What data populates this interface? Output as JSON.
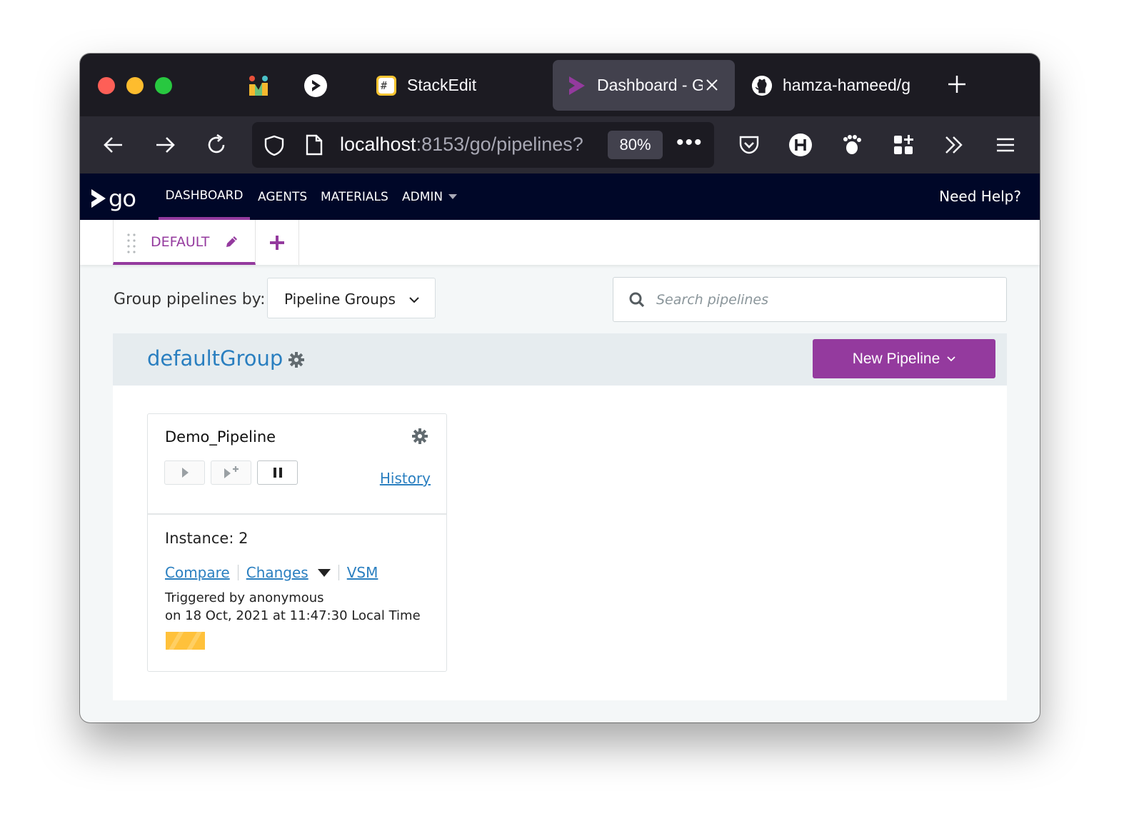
{
  "tabs": [
    {
      "title": "StackEdit"
    },
    {
      "title": "Dashboard - G"
    },
    {
      "title": "hamza-hameed/g"
    }
  ],
  "url": {
    "host": "localhost",
    "rest": ":8153/go/pipelines?",
    "zoom": "80%",
    "more": "•••"
  },
  "go": {
    "logo": "go",
    "nav": [
      "DASHBOARD",
      "AGENTS",
      "MATERIALS",
      "ADMIN"
    ],
    "help": "Need Help?"
  },
  "dashboard": {
    "tab_label": "DEFAULT",
    "group_by_label": "Group pipelines by:",
    "group_by_value": "Pipeline Groups",
    "search_placeholder": "Search pipelines",
    "group_name": "defaultGroup",
    "new_pipeline": "New Pipeline"
  },
  "pipeline": {
    "name": "Demo_Pipeline",
    "history": "History",
    "instance": "Instance: 2",
    "compare": "Compare",
    "changes": "Changes",
    "vsm": "VSM",
    "triggered_by": "Triggered by anonymous",
    "triggered_on": "on 18 Oct, 2021 at 11:47:30 Local Time",
    "stage_color": "#ffc13b"
  },
  "colors": {
    "accent": "#943a9e",
    "link": "#2a7fc0",
    "header": "#000728"
  }
}
